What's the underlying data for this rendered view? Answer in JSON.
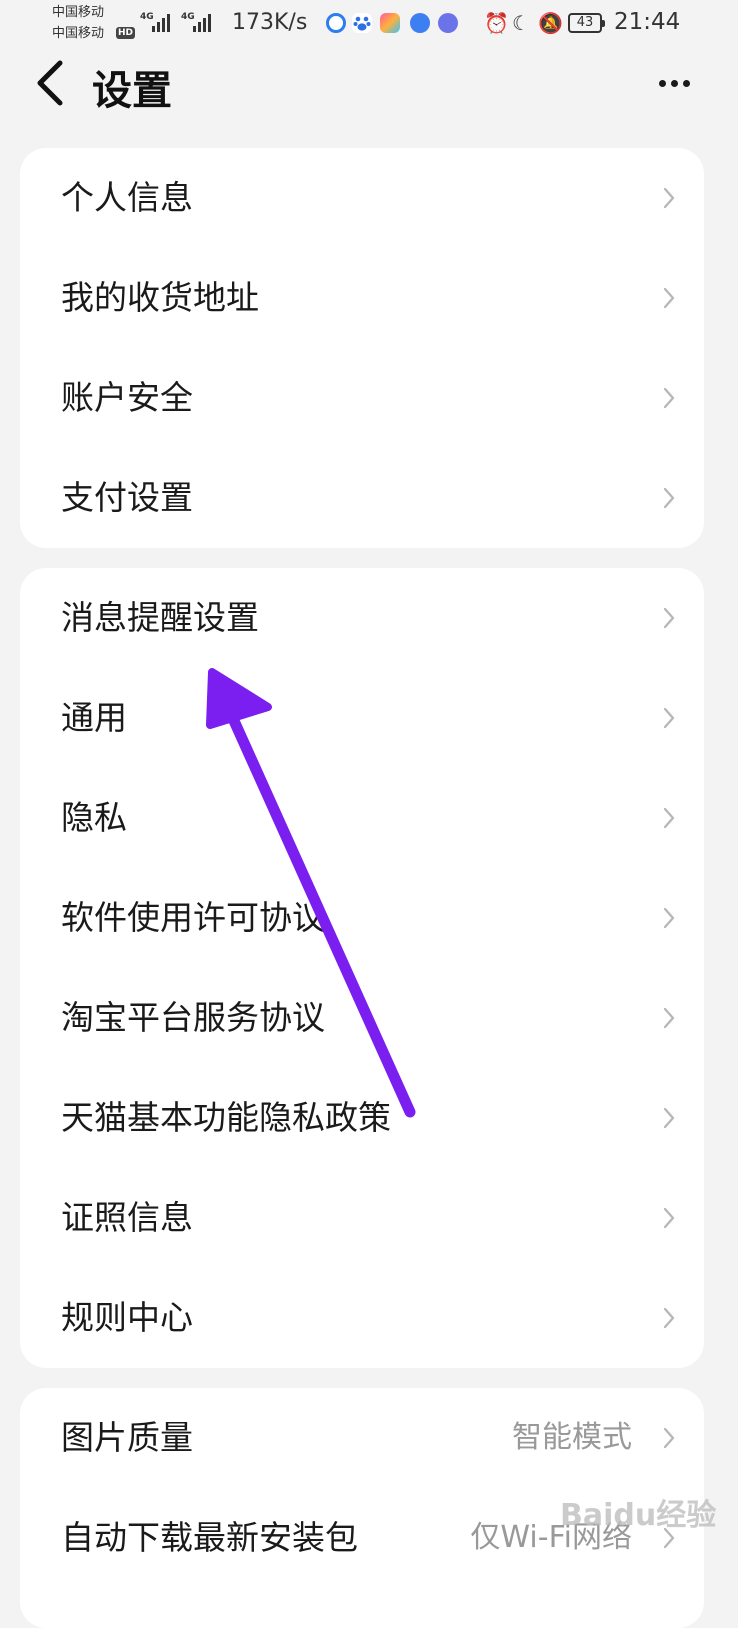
{
  "status_bar": {
    "carrier_1": "中国移动",
    "carrier_2": "中国移动",
    "hd_badge": "HD",
    "signal_1_tag": "4G",
    "signal_2_tag": "4G",
    "speed": "173K/s",
    "battery_level": "43",
    "time": "21:44"
  },
  "header": {
    "title": "设置",
    "back_icon": "chevron-left-icon",
    "more_icon": "more-horizontal-icon"
  },
  "groups": [
    {
      "items": [
        {
          "label": "个人信息"
        },
        {
          "label": "我的收货地址"
        },
        {
          "label": "账户安全"
        },
        {
          "label": "支付设置"
        }
      ]
    },
    {
      "items": [
        {
          "label": "消息提醒设置"
        },
        {
          "label": "通用"
        },
        {
          "label": "隐私"
        },
        {
          "label": "软件使用许可协议"
        },
        {
          "label": "淘宝平台服务协议"
        },
        {
          "label": "天猫基本功能隐私政策"
        },
        {
          "label": "证照信息"
        },
        {
          "label": "规则中心"
        }
      ]
    },
    {
      "items": [
        {
          "label": "图片质量",
          "value": "智能模式"
        },
        {
          "label": "自动下载最新安装包",
          "value": "仅Wi-Fi网络"
        }
      ]
    }
  ],
  "annotation": {
    "arrow_color": "#7a1ff0",
    "arrow_target": "消息提醒设置"
  },
  "watermark": {
    "text": "Baidu经验"
  },
  "colors": {
    "background": "#f3f3f3",
    "card": "#ffffff",
    "secondary_text": "#999999"
  }
}
